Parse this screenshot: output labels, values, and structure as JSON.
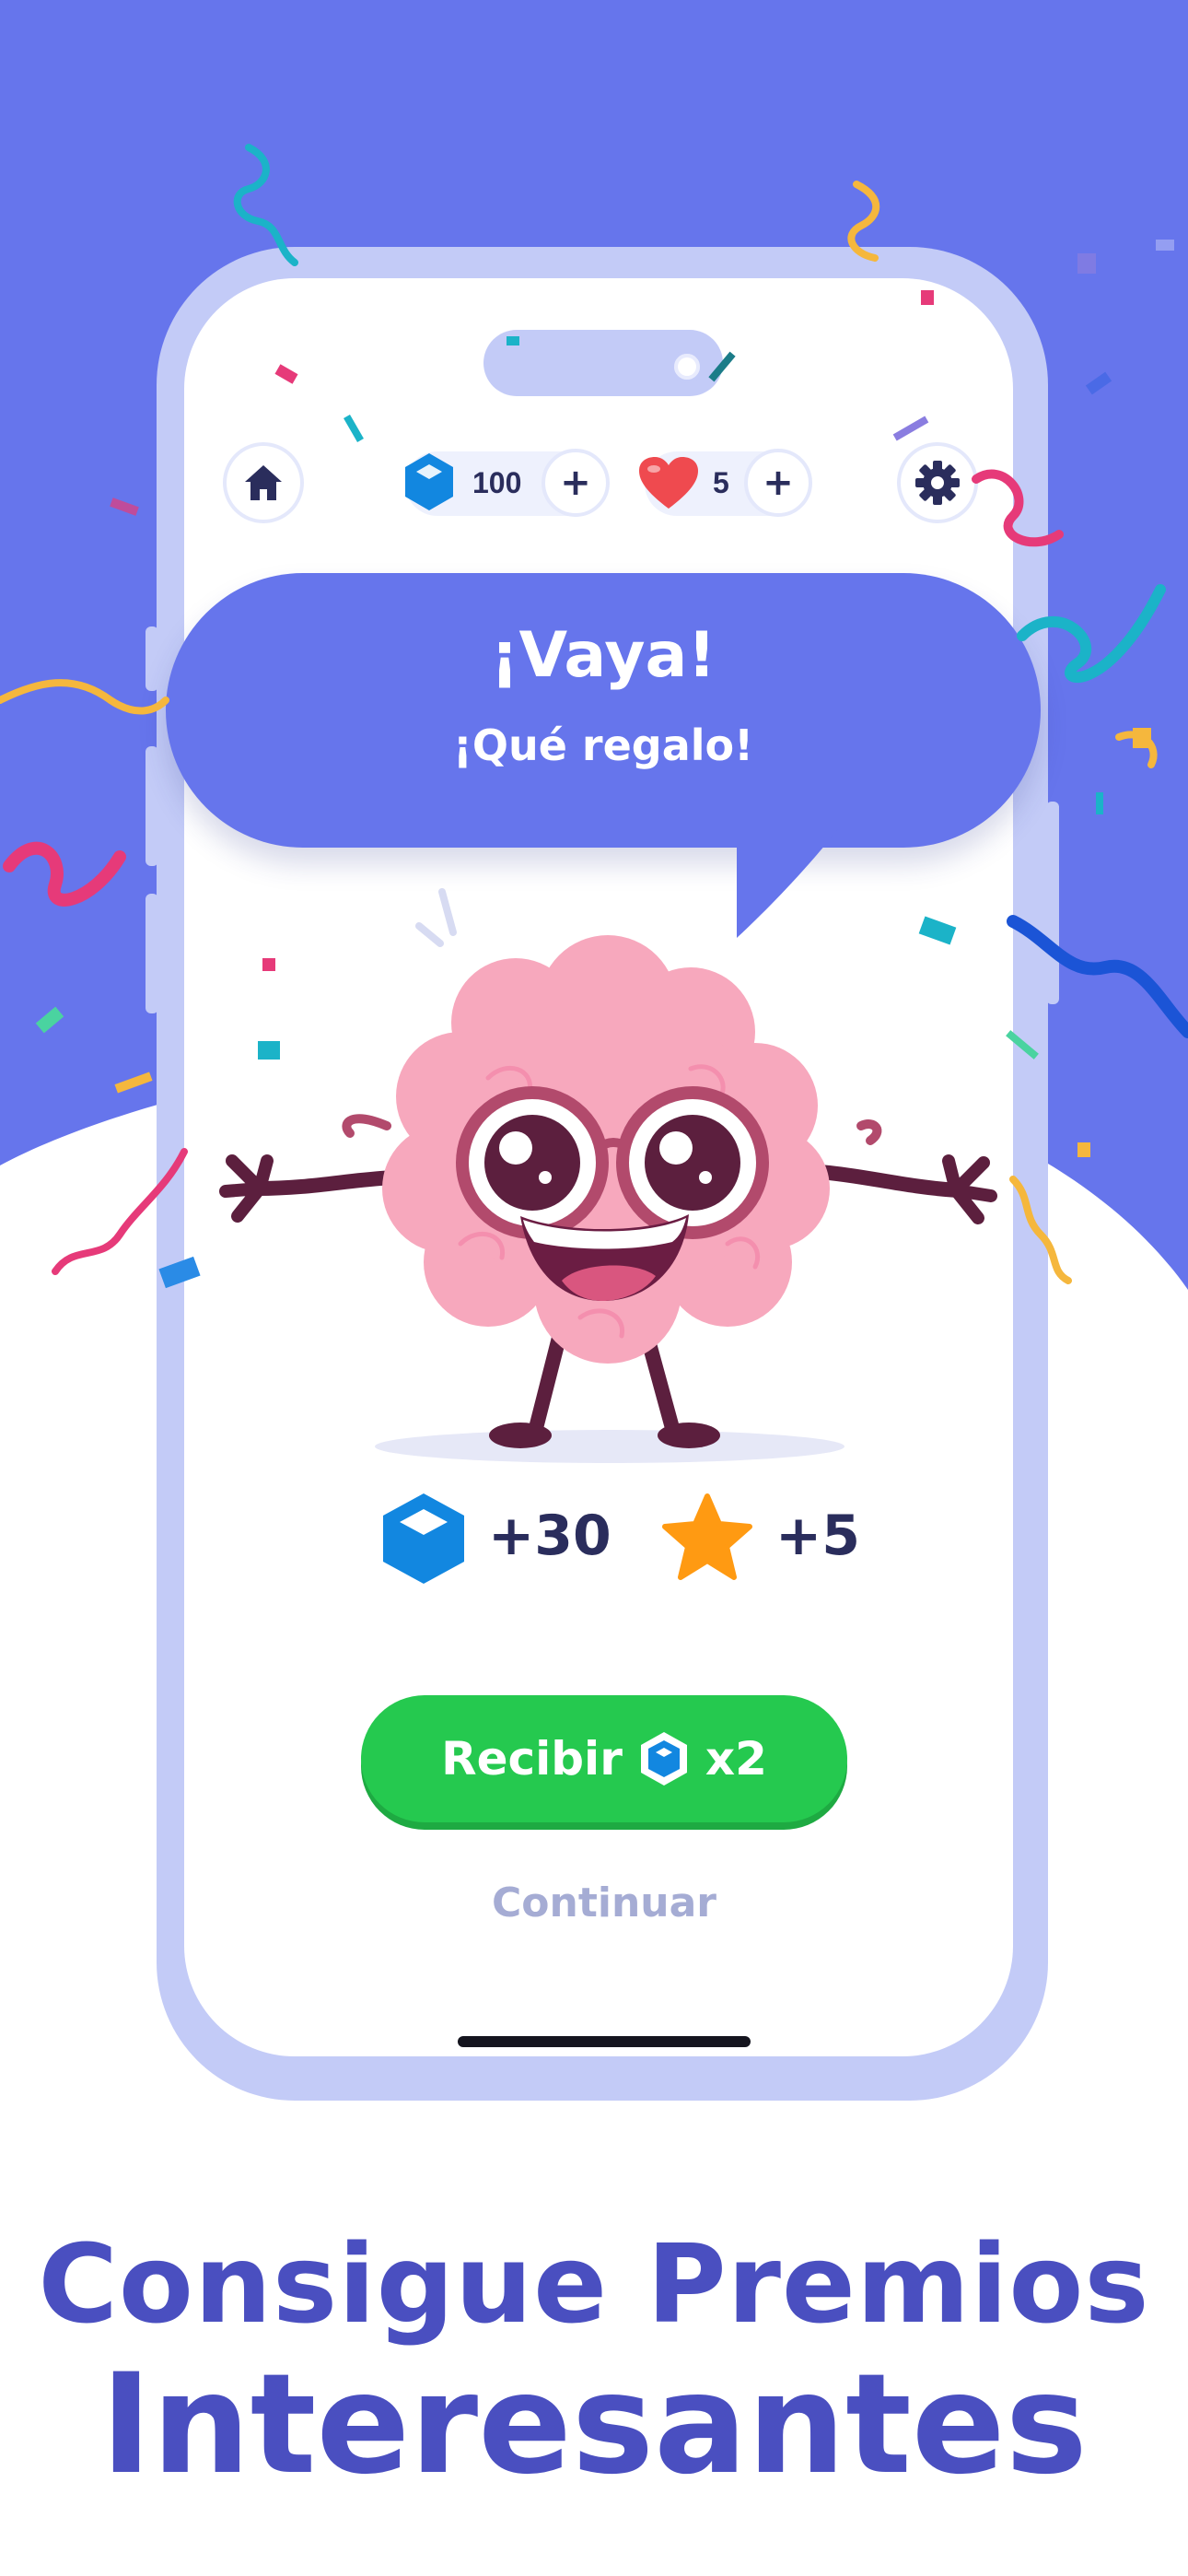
{
  "top_bar": {
    "gems": "100",
    "lives": "5",
    "plus": "+"
  },
  "bubble": {
    "title": "¡Vaya!",
    "subtitle": "¡Qué regalo!"
  },
  "rewards": {
    "gems": "+30",
    "stars": "+5"
  },
  "actions": {
    "receive_label": "Recibir",
    "multiplier": "x2",
    "continue_label": "Continuar"
  },
  "headline": {
    "line1": "Consigue Premios",
    "line2": "Interesantes"
  },
  "colors": {
    "background": "#6675ec",
    "phone_frame": "#c3cbf7",
    "accent_green": "#25c94f",
    "headline": "#4a4fc0",
    "gem_blue": "#1287e0",
    "heart_red": "#ef4a4f",
    "star_orange": "#ff9a12"
  },
  "icons": [
    "home-icon",
    "gem-icon",
    "heart-icon",
    "gear-icon",
    "star-icon",
    "brain-mascot"
  ]
}
